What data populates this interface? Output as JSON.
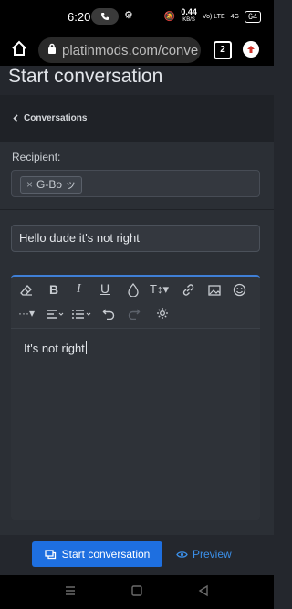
{
  "status": {
    "time": "6:20",
    "net_speed": "0.44",
    "net_unit": "KB/S",
    "signal1": "Vo) LTE",
    "signal2": "4G",
    "battery": "64"
  },
  "browser": {
    "url": "platinmods.com/conve",
    "tab_count": "2"
  },
  "page": {
    "title": "Start conversation",
    "breadcrumb": "Conversations"
  },
  "form": {
    "recipient_label": "Recipient:",
    "recipient_chip": "G-Bo ッ",
    "subject_value": "Hello dude it's not right",
    "message_text": "It's not right"
  },
  "actions": {
    "start_label": "Start conversation",
    "preview_label": "Preview"
  },
  "colors": {
    "accent": "#1e6fe0",
    "link": "#3b8fe8",
    "editor_focus": "#3f7fd6"
  }
}
